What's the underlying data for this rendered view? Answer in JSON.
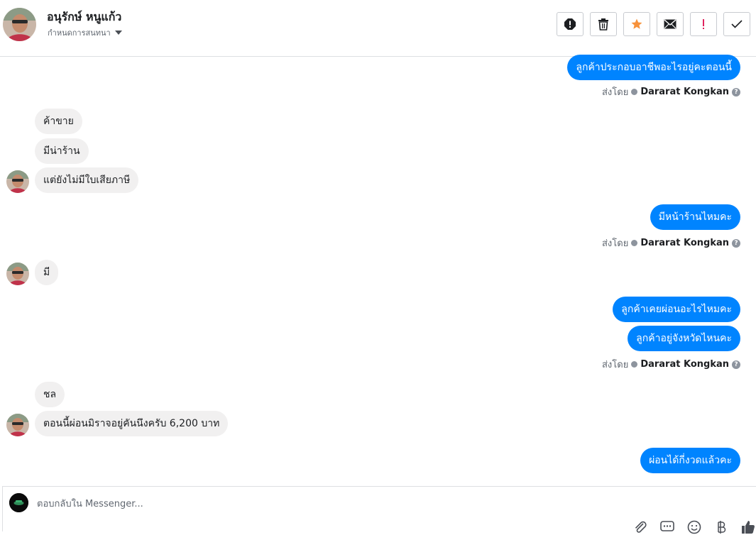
{
  "header": {
    "name": "อนุรักษ์ หนูแก้ว",
    "assign_label": "กำหนดการสนทนา",
    "actions": [
      "spam-icon",
      "trash-icon",
      "star-icon",
      "mail-icon",
      "exclamation-icon",
      "check-icon"
    ],
    "star_color": "#f7923b"
  },
  "thread": {
    "m1": "ลูกค้าประกอบอาชีพอะไรอยู่คะตอนนี้",
    "sent_prefix": "ส่งโดย",
    "sender": "Dararat Kongkan",
    "m2": "ค้าขาย",
    "m3": "มีน่าร้าน",
    "m4": "แต่ยังไม่มีใบเสียภาษี",
    "m5": "มีหน้าร้านไหมคะ",
    "m6": "มี",
    "m7": "ลูกค้าเคยผ่อนอะไรไหมคะ",
    "m8": "ลูกค้าอยู่จังหวัดไหนคะ",
    "m9": "ชล",
    "m10": "ตอนนี้ผ่อนมิราจอยู่คันนึงครับ 6,200 บาท",
    "m11": "ผ่อนได้กี่งวดแล้วคะ"
  },
  "composer": {
    "placeholder": "ตอบกลับใน Messenger...",
    "tools": [
      "attach-icon",
      "saved-reply-icon",
      "emoji-icon",
      "currency-icon",
      "like-icon"
    ]
  },
  "colors": {
    "outgoing": "#0084ff",
    "incoming": "#f1f0f0"
  }
}
